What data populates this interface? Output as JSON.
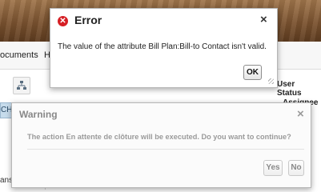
{
  "background": {
    "nav_tabs": [
      "ocuments",
      "H"
    ],
    "left_tab_label": "CH",
    "bottom_left_text": "ans",
    "right_labels": [
      "User Status",
      "Assignee"
    ]
  },
  "error_dialog": {
    "icon": "error-icon",
    "title": "Error",
    "close_label": "×",
    "message": "The value of the attribute Bill Plan:Bill-to Contact isn't valid.",
    "ok_label": "OK"
  },
  "warning_dialog": {
    "title": "Warning",
    "close_label": "×",
    "message": "The action En attente de clôture will be executed. Do you want to continue?",
    "yes_label": "Yes",
    "no_label": "No"
  },
  "colors": {
    "error_icon": "#d61f24",
    "banner": "#7b5330"
  }
}
